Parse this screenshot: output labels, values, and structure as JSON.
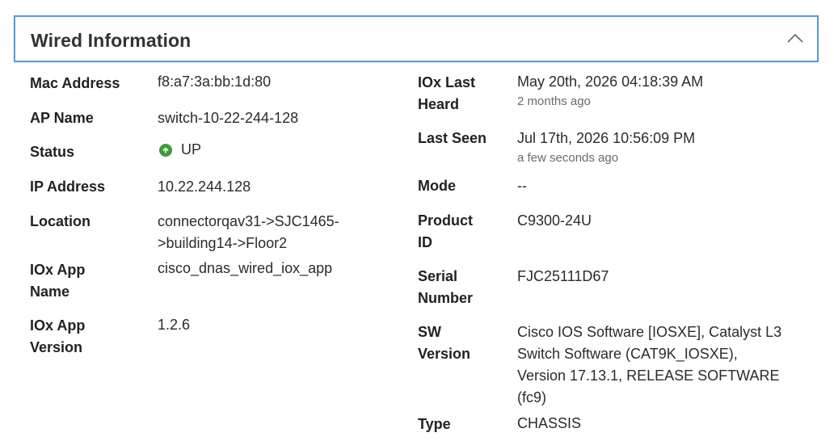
{
  "panel": {
    "title": "Wired Information"
  },
  "left": {
    "mac_label": "Mac Address",
    "mac_value": "f8:a7:3a:bb:1d:80",
    "ap_label": "AP Name",
    "ap_value": "switch-10-22-244-128",
    "status_label": "Status",
    "status_value": "UP",
    "ip_label": "IP Address",
    "ip_value": "10.22.244.128",
    "location_label": "Location",
    "location_line1": "connectorqav31->SJC1465-",
    "location_line2": ">building14->Floor2",
    "iox_app_name_label_1": "IOx App",
    "iox_app_name_label_2": "Name",
    "iox_app_name_value": "cisco_dnas_wired_iox_app",
    "iox_app_version_label_1": "IOx App",
    "iox_app_version_label_2": "Version",
    "iox_app_version_value": "1.2.6"
  },
  "right": {
    "iox_last_heard_label_1": "IOx Last",
    "iox_last_heard_label_2": "Heard",
    "iox_last_heard_value": "May 20th, 2026 04:18:39 AM",
    "iox_last_heard_sub": "2 months ago",
    "last_seen_label": "Last Seen",
    "last_seen_value": "Jul 17th, 2026 10:56:09 PM",
    "last_seen_sub": "a few seconds ago",
    "mode_label": "Mode",
    "mode_value": "--",
    "product_id_label_1": "Product",
    "product_id_label_2": "ID",
    "product_id_value": "C9300-24U",
    "serial_label_1": "Serial",
    "serial_label_2": "Number",
    "serial_value": "FJC25111D67",
    "sw_label_1": "SW",
    "sw_label_2": "Version",
    "sw_line1": "Cisco IOS Software [IOSXE], Catalyst L3",
    "sw_line2": "Switch Software (CAT9K_IOSXE),",
    "sw_line3": "Version 17.13.1, RELEASE SOFTWARE",
    "sw_line4": "(fc9)",
    "type_label": "Type",
    "type_value": "CHASSIS"
  },
  "colors": {
    "header_border": "#5b9bd9",
    "status_up": "#3d9a3d"
  },
  "icons": {
    "collapse": "chevron-up-icon",
    "status": "arrow-up-circle-icon"
  }
}
